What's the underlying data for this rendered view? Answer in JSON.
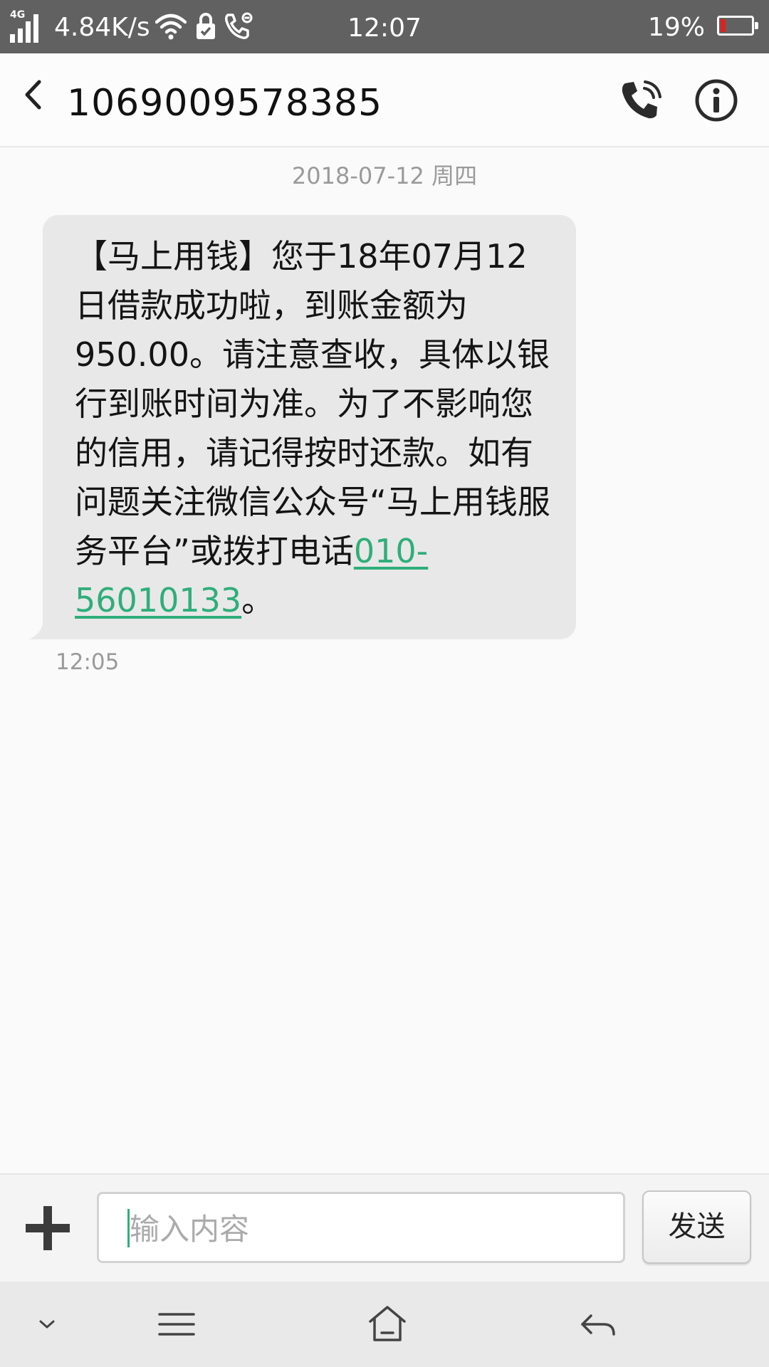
{
  "status_bar": {
    "network_type": "4G",
    "net_speed": "4.84K/s",
    "time": "12:07",
    "battery_percent": "19%",
    "battery_color": "#e02020",
    "icons": [
      "signal-icon",
      "wifi-icon",
      "lock-icon",
      "call-icon"
    ]
  },
  "header": {
    "contact_number": "1069009578385",
    "back_icon": "back-arrow-icon",
    "call_icon": "phone-icon",
    "info_icon": "info-icon"
  },
  "conversation": {
    "date_separator": "2018-07-12 周四",
    "messages": [
      {
        "direction": "incoming",
        "text_before_link": "【马上用钱】您于18年07月12日借款成功啦，到账金额为950.00。请注意查收，具体以银行到账时间为准。为了不影响您的信用，请记得按时还款。如有问题关注微信公众号“马上用钱服务平台”或拨打电话",
        "link_text": "010-56010133",
        "text_after_link": "。",
        "time": "12:05"
      }
    ],
    "link_color": "#2fae7a"
  },
  "compose": {
    "add_icon": "plus-icon",
    "placeholder": "输入内容",
    "send_label": "发送"
  },
  "nav_bar": {
    "icons": [
      "collapse-icon",
      "menu-icon",
      "home-icon",
      "back-icon"
    ]
  }
}
